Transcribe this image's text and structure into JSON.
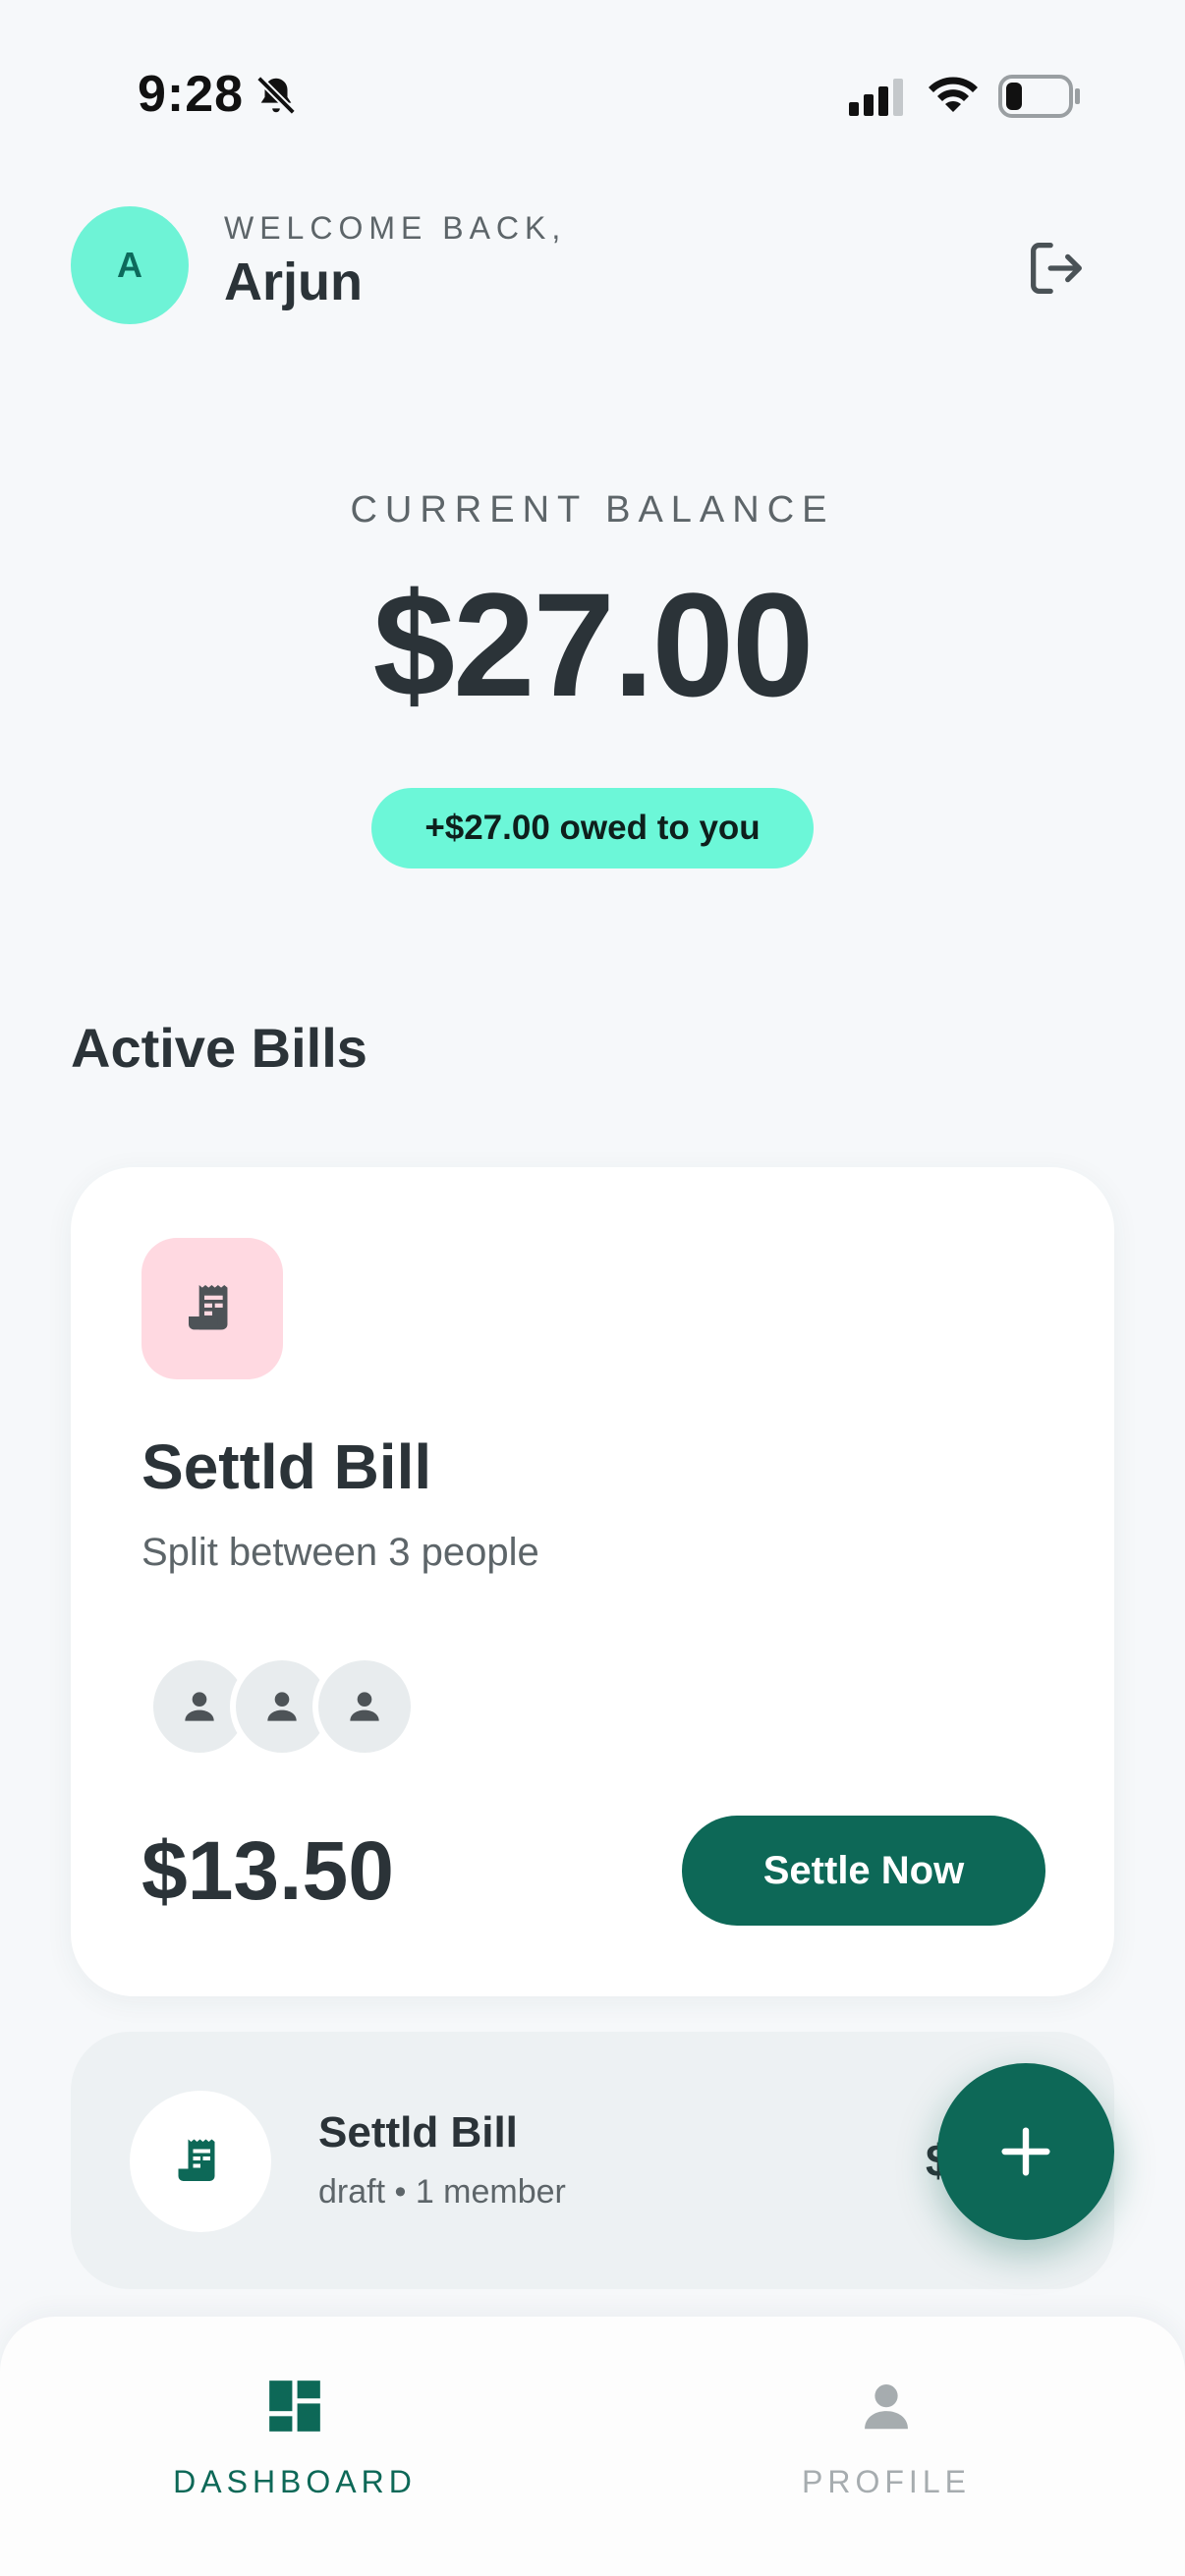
{
  "status_bar": {
    "time": "9:28"
  },
  "header": {
    "avatar_initial": "A",
    "welcome_label": "WELCOME BACK,",
    "user_name": "Arjun"
  },
  "balance": {
    "label": "CURRENT BALANCE",
    "amount": "$27.00",
    "owed_badge": "+$27.00 owed to you"
  },
  "active_bills": {
    "title": "Active Bills",
    "featured": {
      "title": "Settld Bill",
      "subtitle": "Split between 3 people",
      "member_count": 3,
      "amount": "$13.50",
      "settle_label": "Settle Now"
    },
    "list": [
      {
        "title": "Settld Bill",
        "subtitle": "draft • 1 member",
        "amount_visible": "$"
      }
    ]
  },
  "bottom_nav": {
    "items": [
      {
        "label": "DASHBOARD",
        "icon": "dashboard-icon",
        "active": true
      },
      {
        "label": "PROFILE",
        "icon": "person-icon",
        "active": false
      }
    ]
  },
  "colors": {
    "accent_dark": "#0d6857",
    "accent_mint": "#6cf7d8",
    "receipt_tile": "#ffd9e1",
    "text_primary": "#2b3338",
    "text_secondary": "#5d6569",
    "nav_inactive": "#a6acaf"
  }
}
